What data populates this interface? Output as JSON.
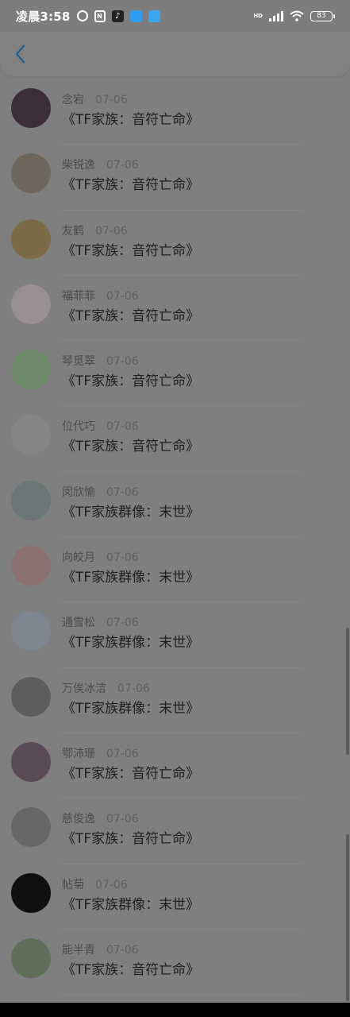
{
  "status_bar": {
    "time": "凌晨3:58",
    "network": "HD",
    "battery": "83",
    "icons": [
      "alarm-icon",
      "nfc-icon",
      "tiktok-icon",
      "chat-bubble-icon",
      "cloud-icon",
      "signal-icon",
      "wifi-icon",
      "battery-icon"
    ]
  },
  "nav": {
    "back_icon": "chevron-left-icon",
    "accent_color": "#1f78c8"
  },
  "messages": [
    {
      "name": "念宕",
      "date": "07-06",
      "text": "《TF家族：音符亡命》",
      "avatar_color": "#3d2f3a"
    },
    {
      "name": "柴锐逸",
      "date": "07-06",
      "text": "《TF家族：音符亡命》",
      "avatar_color": "#6e665a"
    },
    {
      "name": "友鹤",
      "date": "07-06",
      "text": "《TF家族：音符亡命》",
      "avatar_color": "#7a6a45"
    },
    {
      "name": "福菲菲",
      "date": "07-06",
      "text": "《TF家族：音符亡命》",
      "avatar_color": "#9a8f94"
    },
    {
      "name": "琴觅翠",
      "date": "07-06",
      "text": "《TF家族：音符亡命》",
      "avatar_color": "#6f8a6a"
    },
    {
      "name": "位代巧",
      "date": "07-06",
      "text": "《TF家族：音符亡命》",
      "avatar_color": "#858585"
    },
    {
      "name": "闵欣愉",
      "date": "07-06",
      "text": "《TF家族群像：末世》",
      "avatar_color": "#6a7575"
    },
    {
      "name": "向皎月",
      "date": "07-06",
      "text": "《TF家族群像：末世》",
      "avatar_color": "#8a7070"
    },
    {
      "name": "通雪松",
      "date": "07-06",
      "text": "《TF家族群像：末世》",
      "avatar_color": "#7c8590"
    },
    {
      "name": "万俟冰洁",
      "date": "07-06",
      "text": "《TF家族群像：末世》",
      "avatar_color": "#5d5d5d"
    },
    {
      "name": "鄂沛珊",
      "date": "07-06",
      "text": "《TF家族：音符亡命》",
      "avatar_color": "#5a4a55"
    },
    {
      "name": "慈俊逸",
      "date": "07-06",
      "text": "《TF家族：音符亡命》",
      "avatar_color": "#666666"
    },
    {
      "name": "帖菊",
      "date": "07-06",
      "text": "《TF家族群像：末世》",
      "avatar_color": "#101010"
    },
    {
      "name": "能半青",
      "date": "07-06",
      "text": "《TF家族：音符亡命》",
      "avatar_color": "#5e6e58"
    }
  ]
}
